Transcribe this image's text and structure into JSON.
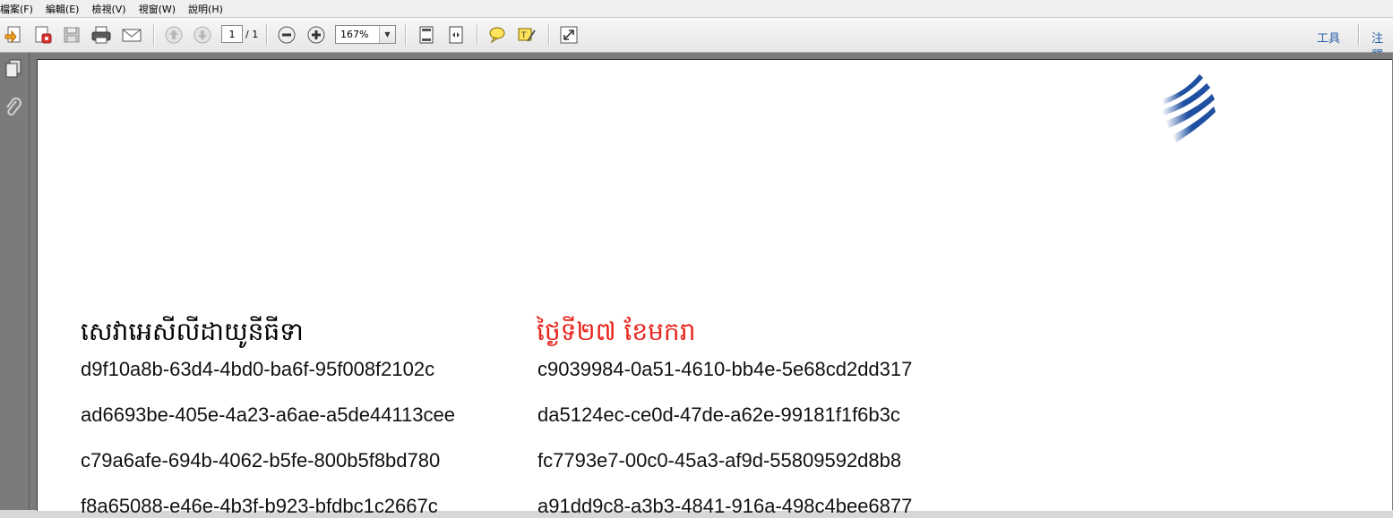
{
  "menu": [
    "檔案(F)",
    "編輯(E)",
    "檢視(V)",
    "視窗(W)",
    "說明(H)"
  ],
  "toolbar": {
    "page_current": "1",
    "page_total": "/ 1",
    "zoom": "167%",
    "tools_label": "工具",
    "comment_label": "注釋"
  },
  "document": {
    "header_left": "សេវាអេសីលីដាយូនីធីទា",
    "header_right": "ថ្ងៃទី២៧ ខែមករា",
    "header_right_color": "#e8231c",
    "logo_color": "#1f4fa0",
    "left_column": [
      "d9f10a8b-63d4-4bd0-ba6f-95f008f2102c",
      "ad6693be-405e-4a23-a6ae-a5de44113cee",
      "c79a6afe-694b-4062-b5fe-800b5f8bd780",
      "f8a65088-e46e-4b3f-b923-bfdbc1c2667c"
    ],
    "right_column": [
      "c9039984-0a51-4610-bb4e-5e68cd2dd317",
      "da5124ec-ce0d-47de-a62e-99181f1f6b3c",
      "fc7793e7-00c0-45a3-af9d-55809592d8b8",
      "a91dd9c8-a3b3-4841-916a-498c4bee6877"
    ]
  }
}
